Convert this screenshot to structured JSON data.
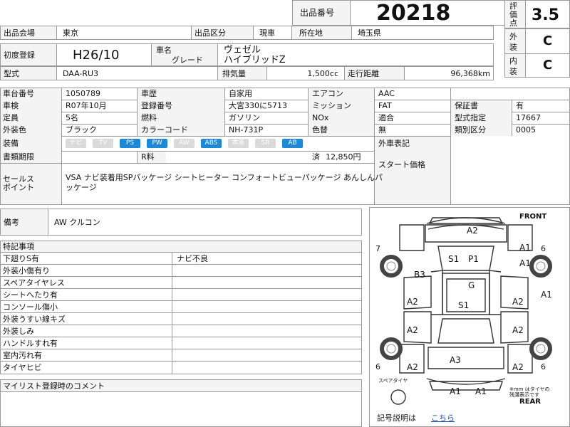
{
  "header": {
    "lot_label": "出品番号",
    "lot_number": "20218",
    "score_label": "評価点",
    "score": "3.5",
    "exterior_label": "外装",
    "exterior_grade": "C",
    "interior_label": "内装",
    "interior_grade": "C"
  },
  "row1": {
    "venue_label": "出品会場",
    "venue": "東京",
    "type_label": "出品区分",
    "type": "現車",
    "location_label": "所在地",
    "location": "埼玉県"
  },
  "row2": {
    "reg_label": "初度登録",
    "reg": "H26/10",
    "name_label": "車名",
    "grade_label": "グレード",
    "name": "ヴェゼル",
    "grade": "ハイブリッドZ"
  },
  "row3": {
    "model_label": "型式",
    "model": "DAA-RU3",
    "disp_label": "排気量",
    "disp": "1,500cc",
    "mileage_label": "走行距離",
    "mileage": "96,368km"
  },
  "details": {
    "chassis_label": "車台番号",
    "chassis": "1050789",
    "history_label": "車歴",
    "history": "自家用",
    "aircon_label": "エアコン",
    "aircon": "AAC",
    "inspection_label": "車検",
    "inspection": "R07年10月",
    "plate_label": "登録番号",
    "plate": "大宮330に5713",
    "mission_label": "ミッション",
    "mission": "FAT",
    "warranty_label": "保証書",
    "warranty": "有",
    "capacity_label": "定員",
    "capacity": "5名",
    "fuel_label": "燃料",
    "fuel": "ガソリン",
    "nox_label": "NOx",
    "nox": "適合",
    "type_cert_label": "型式指定",
    "type_cert": "17667",
    "color_label": "外装色",
    "color": "ブラック",
    "color_code_label": "カラーコード",
    "color_code": "NH-731P",
    "repaint_label": "色替",
    "repaint": "無",
    "class_label": "類別区分",
    "class": "0005",
    "equip_label": "装備",
    "docs_label": "書類期限",
    "recycle_label": "R料",
    "recycle_status": "済",
    "recycle_amount": "12,850円",
    "foreign_label": "外車表記",
    "start_label": "スタート価格"
  },
  "equipment": [
    {
      "label": "ナビ",
      "on": false
    },
    {
      "label": "TV",
      "on": false
    },
    {
      "label": "PS",
      "on": true
    },
    {
      "label": "PW",
      "on": true
    },
    {
      "label": "AW",
      "on": false
    },
    {
      "label": "ABS",
      "on": true
    },
    {
      "label": "本革",
      "on": false
    },
    {
      "label": "SR",
      "on": false
    },
    {
      "label": "AB",
      "on": true
    }
  ],
  "sales": {
    "label1": "セールス",
    "label2": "ポイント",
    "text1": "VSA ナビ装着用SPパッケージ シートヒーター コンフォートビューパッケージ あんしんパ",
    "text2": "ッケージ"
  },
  "notes": {
    "label": "備考",
    "text": "AW クルコン"
  },
  "special": {
    "label": "特記事項",
    "rows": [
      {
        "left": "下廻りS有",
        "right": "ナビ不良"
      },
      {
        "left": "外装小傷有り",
        "right": ""
      },
      {
        "left": "スペアタイヤレス",
        "right": ""
      },
      {
        "left": "シートへたり有",
        "right": ""
      },
      {
        "left": "コンソール傷小",
        "right": ""
      },
      {
        "left": "外装うすい線キズ",
        "right": ""
      },
      {
        "left": "外装しみ",
        "right": ""
      },
      {
        "left": "ハンドルすれ有",
        "right": ""
      },
      {
        "left": "室内汚れ有",
        "right": ""
      },
      {
        "left": "タイヤヒビ",
        "right": ""
      }
    ]
  },
  "mylist": {
    "label": "マイリスト登録時のコメント"
  },
  "diagram": {
    "front": "FRONT",
    "rear": "REAR",
    "spare": "スペアタイヤ",
    "note1": "※mm はタイヤの",
    "note2": "残溝表示です",
    "legend_label": "記号説明は",
    "legend_link": "こちら",
    "tire_fl": "7",
    "tire_fr": "6",
    "tire_rl": "6",
    "tire_rr": "6",
    "marks": {
      "hood": "A2",
      "front_left": "B3",
      "front_right_a": "A1",
      "front_right_b": "A1",
      "seat_s1": "S1",
      "seat_p1": "P1",
      "glass_g": "G",
      "roof_s1": "S1",
      "left_door_front": "A2",
      "left_door_rear": "A2",
      "right_door_front": "A2",
      "right_door_rear": "A2",
      "right_side": "A1",
      "rear_left": "A2",
      "rear_right": "A2",
      "trunk": "A3",
      "bumper_l": "A1",
      "bumper_r": "A1"
    }
  }
}
